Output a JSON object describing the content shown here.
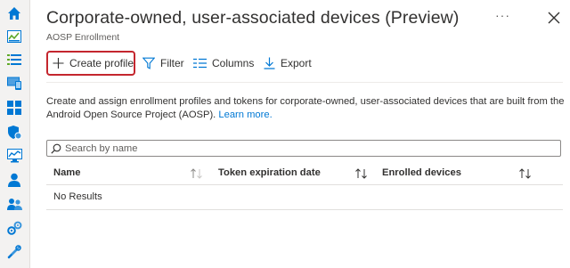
{
  "sidebar": {
    "icons": [
      "home-icon",
      "dashboard-icon",
      "all-services-icon",
      "devices-icon",
      "apps-icon",
      "endpoint-security-icon",
      "reports-icon",
      "users-icon",
      "groups-icon",
      "tenant-administration-icon",
      "troubleshooting-icon"
    ]
  },
  "header": {
    "title": "Corporate-owned, user-associated devices (Preview)",
    "subtitle": "AOSP Enrollment",
    "more": "···"
  },
  "toolbar": {
    "create_label": "Create profile",
    "filter_label": "Filter",
    "columns_label": "Columns",
    "export_label": "Export"
  },
  "description": {
    "text": "Create and assign enrollment profiles and tokens for corporate-owned, user-associated devices that are built from the Android Open Source Project (AOSP). ",
    "link": "Learn more."
  },
  "search": {
    "placeholder": "Search by name"
  },
  "table": {
    "columns": [
      "Name",
      "Token expiration date",
      "Enrolled devices"
    ],
    "empty_text": "No Results"
  },
  "colors": {
    "accent": "#0078d4",
    "highlight": "#c4262e"
  }
}
